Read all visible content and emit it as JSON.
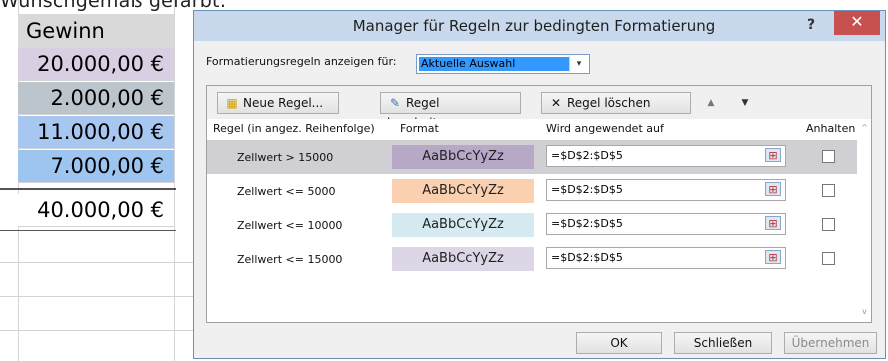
{
  "sheet": {
    "top_text": "Wunschgemäß gefärbt:",
    "header": "Gewinn",
    "cells": [
      {
        "value": "20.000,00 €",
        "color": "#d9cfe3"
      },
      {
        "value": "2.000,00 €",
        "color": "#bcc4cc"
      },
      {
        "value": "11.000,00 €",
        "color": "#a7c6f0"
      },
      {
        "value": "7.000,00 €",
        "color": "#9ec4f0"
      }
    ],
    "total": "40.000,00 €"
  },
  "dialog": {
    "title": "Manager für Regeln zur bedingten Formatierung",
    "help": "?",
    "close": "✕",
    "show_label": "Formatierungsregeln anzeigen für:",
    "scope_value": "Aktuelle Auswahl",
    "buttons": {
      "new_rule": "Neue Regel...",
      "edit_rule": "Regel bearbeiten...",
      "delete_rule": "Regel löschen"
    },
    "columns": {
      "rule": "Regel (in angez. Reihenfolge)",
      "format": "Format",
      "applies": "Wird angewendet auf",
      "stop": "Anhalten"
    },
    "rows": [
      {
        "rule": "Zellwert > 15000",
        "preview": "AaBbCcYyZz",
        "color": "#b8a8c8",
        "applies": "=$D$2:$D$5",
        "stop": false
      },
      {
        "rule": "Zellwert <= 5000",
        "preview": "AaBbCcYyZz",
        "color": "#fbd0b0",
        "applies": "=$D$2:$D$5",
        "stop": false
      },
      {
        "rule": "Zellwert <= 10000",
        "preview": "AaBbCcYyZz",
        "color": "#d6ebf1",
        "applies": "=$D$2:$D$5",
        "stop": false
      },
      {
        "rule": "Zellwert <= 15000",
        "preview": "AaBbCcYyZz",
        "color": "#dcd6e6",
        "applies": "=$D$2:$D$5",
        "stop": false
      }
    ],
    "footer": {
      "ok": "OK",
      "close": "Schließen",
      "apply": "Übernehmen"
    }
  }
}
